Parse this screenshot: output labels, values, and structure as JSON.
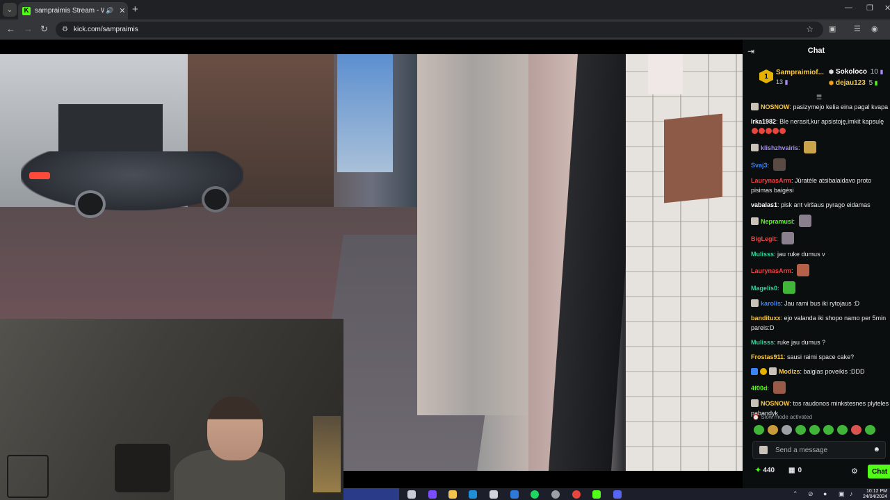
{
  "browser": {
    "tab_title": "sampraimis Stream - Watch Live on Kick",
    "favicon_letter": "K",
    "url": "kick.com/sampraimis"
  },
  "chat": {
    "title": "Chat",
    "pinned": {
      "name": "Sampraimiof...",
      "count": "13",
      "leaders": [
        {
          "name": "Sokoloco",
          "value": "10",
          "color": "#ffffff"
        },
        {
          "name": "dejau123",
          "value": "5",
          "color": "#f7c94a"
        }
      ]
    },
    "messages": [
      {
        "user": "NOSNOW",
        "color": "#f7c94a",
        "badge": "square",
        "text": "pasizymejo kelia eina pagal kvapa",
        "wrap": true
      },
      {
        "user": "Irka1982",
        "color": "#ffffff",
        "badge": "",
        "text": "Ble nerasit,kur apsistoję,imkit kapsulę",
        "wrap": false,
        "emotes_small": 5
      },
      {
        "user": "klishzhvairis",
        "color": "#a78bfa",
        "badge": "square",
        "text": "",
        "emote": "#c9a44a"
      },
      {
        "user": "Svaj3",
        "color": "#3b82f6",
        "badge": "",
        "text": "",
        "emote": "#5a4a44"
      },
      {
        "user": "LaurynasArm",
        "color": "#ef4444",
        "badge": "",
        "text": "Jūratėle atsibalaidavo proto pisimas baigėsi",
        "wrap": true
      },
      {
        "user": "vabalas1",
        "color": "#ffffff",
        "badge": "",
        "text": "pisk ant viršaus pyrago eidamas",
        "wrap": false
      },
      {
        "user": "Nepramusi",
        "color": "#53fc18",
        "badge": "square",
        "text": "",
        "emote": "#8a7f8c"
      },
      {
        "user": "BigLegit",
        "color": "#ef4444",
        "badge": "",
        "text": "",
        "emote": "#8a7f8c"
      },
      {
        "user": "Mulisss",
        "color": "#34d399",
        "badge": "",
        "text": "jau ruke dumus v",
        "wrap": false
      },
      {
        "user": "LaurynasArm",
        "color": "#ef4444",
        "badge": "",
        "text": "",
        "emote": "#b5614a"
      },
      {
        "user": "Magelis0",
        "color": "#34d399",
        "badge": "",
        "text": "",
        "emote": "#40b53a"
      },
      {
        "user": "karolis",
        "color": "#3b82f6",
        "badge": "square",
        "text": "Jau rami bus iki rytojaus :D",
        "wrap": false
      },
      {
        "user": "bandituxx",
        "color": "#f7c94a",
        "badge": "",
        "text": "ejo valanda iki shopo namo per 5min pareis:D",
        "wrap": true
      },
      {
        "user": "Mulisss",
        "color": "#34d399",
        "badge": "",
        "text": "ruke jau dumus ?",
        "wrap": false
      },
      {
        "user": "Frostas911",
        "color": "#f7c94a",
        "badge": "",
        "text": "sausi raimi space cake?",
        "wrap": false
      },
      {
        "user": "Modizs",
        "color": "#f7c94a",
        "badge": "multi",
        "text": "baigias poveikis :DDD",
        "wrap": false
      },
      {
        "user": "4f00d",
        "color": "#53fc18",
        "badge": "",
        "text": "",
        "emote": "#9a5a48"
      },
      {
        "user": "NOSNOW",
        "color": "#f7c94a",
        "badge": "square",
        "text": "tos raudonos minkstesnes plyteles pabandyk",
        "wrap": true
      }
    ],
    "slow_mode": "Slow mode activated",
    "input_placeholder": "Send a message",
    "points": "440",
    "drops": "0",
    "send_label": "Chat"
  },
  "taskbar": {
    "time": "10:12 PM",
    "date": "24/04/2024"
  }
}
